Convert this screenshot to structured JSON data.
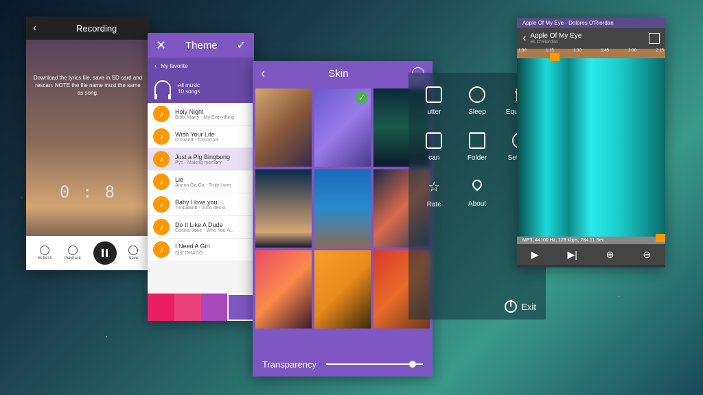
{
  "recording": {
    "title": "Recording",
    "message": "Download the lyrics file, save in SD card and rescan. NOTE the file name must the same as song.",
    "time": "0 : 8",
    "controls": {
      "refresh": "Refresh",
      "playback": "Playback",
      "save": "Save"
    }
  },
  "theme": {
    "title": "Theme",
    "favorite": "My favorite",
    "allmusic": {
      "title": "All music",
      "sub": "10 songs"
    },
    "songs": [
      {
        "title": "Holy Night",
        "sub": "Bibbi Marry - My Everything"
      },
      {
        "title": "Wish Your Life",
        "sub": "D Grand - Tomorrow"
      },
      {
        "title": "Just a Pig Bingbong",
        "sub": "Pys - Making memory"
      },
      {
        "title": "Lie",
        "sub": "Ariana Ga Ga - Truly Love"
      },
      {
        "title": "Baby I love you",
        "sub": "Timbalanb - Juno demo"
      },
      {
        "title": "Do It Like A Dude",
        "sub": "Connie Jone - Who You A..."
      },
      {
        "title": "I Need A Girl",
        "sub": "태양 DRAGO"
      }
    ],
    "colors": [
      "#e91e63",
      "#ec407a",
      "#ab47bc",
      "#7e57c2"
    ]
  },
  "skin": {
    "title": "Skin",
    "transparency": "Transparency",
    "thumbs": [
      "linear-gradient(135deg,#d4a574,#8b5a3a,#3a2a4a)",
      "linear-gradient(135deg,#6a5acd,#9a7aea,#4a3a8a)",
      "linear-gradient(180deg,#0a2a3a,#1a5a4a,#0a1a2a)",
      "linear-gradient(180deg,#0a2a4a,#d4a574 80%,#1a1a2e)",
      "linear-gradient(180deg,#1a6aba,#2a8aca,#8a6a5a)",
      "linear-gradient(135deg,#1a2a4a,#da6a4a,#2a3a5a)",
      "linear-gradient(135deg,#ea4a6a,#fa8a4a,#3a1a2a)",
      "linear-gradient(135deg,#fa9a2a,#ea8a1a,#3a2a0a)",
      "linear-gradient(135deg,#da3a2a,#ea6a2a,#6a3a1a)"
    ]
  },
  "menu": {
    "items": [
      "utter",
      "Sleep",
      "Equalizer",
      "can",
      "Folder",
      "Settings",
      "Rate",
      "About"
    ],
    "exit": "Exit"
  },
  "editor": {
    "windowTitle": "Apple Of My Eye - Dolores O'Riordan",
    "song": "Apple Of My Eye",
    "artist": "es O'Riordan",
    "ruler": [
      "1:00",
      "1:15",
      "1:30",
      "1:45",
      "2:00",
      "2:15"
    ],
    "info": "MP3, 44100 Hz, 128 kbps, 284.11 Sec"
  }
}
